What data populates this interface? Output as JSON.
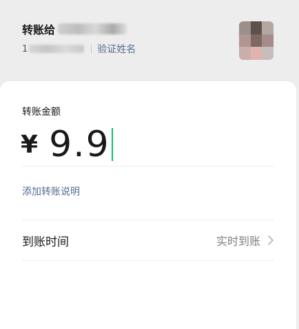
{
  "header": {
    "recipient_label": "转账给",
    "account_prefix": "1",
    "verify_name_link": "验证姓名"
  },
  "transfer": {
    "amount_label": "转账金额",
    "currency_symbol": "¥",
    "amount": "9.9",
    "add_remark_link": "添加转账说明",
    "arrival_time_label": "到账时间",
    "arrival_time_value": "实时到账"
  },
  "colors": {
    "link": "#576b95",
    "cursor": "#07c160",
    "background": "#ededed",
    "card": "#ffffff"
  },
  "icons": {
    "chevron": "chevron-right-icon",
    "avatar": "avatar"
  }
}
